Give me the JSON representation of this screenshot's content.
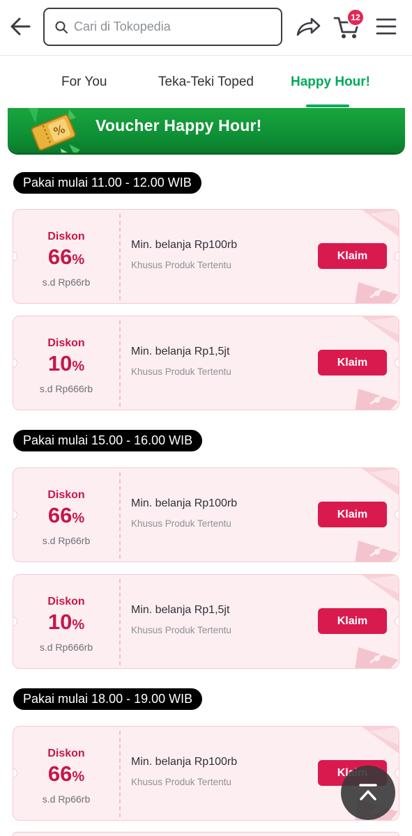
{
  "header": {
    "search_placeholder": "Cari di Tokopedia",
    "cart_count": "12"
  },
  "tabs": [
    {
      "label": "For You",
      "active": false
    },
    {
      "label": "Teka-Teki Toped",
      "active": false
    },
    {
      "label": "Happy Hour!",
      "active": true
    }
  ],
  "banner": {
    "title": "Voucher Happy Hour!"
  },
  "slots": [
    {
      "label": "Pakai mulai 11.00 - 12.00 WIB",
      "vouchers": [
        {
          "discount_label": "Diskon",
          "discount_value": "66",
          "percent": "%",
          "max": "s.d Rp66rb",
          "min_purchase": "Min. belanja Rp100rb",
          "note": "Khusus Produk Tertentu",
          "button": "Klaim"
        },
        {
          "discount_label": "Diskon",
          "discount_value": "10",
          "percent": "%",
          "max": "s.d Rp666rb",
          "min_purchase": "Min. belanja Rp1,5jt",
          "note": "Khusus Produk Tertentu",
          "button": "Klaim"
        }
      ]
    },
    {
      "label": "Pakai mulai 15.00 - 16.00 WIB",
      "vouchers": [
        {
          "discount_label": "Diskon",
          "discount_value": "66",
          "percent": "%",
          "max": "s.d Rp66rb",
          "min_purchase": "Min. belanja Rp100rb",
          "note": "Khusus Produk Tertentu",
          "button": "Klaim"
        },
        {
          "discount_label": "Diskon",
          "discount_value": "10",
          "percent": "%",
          "max": "s.d Rp666rb",
          "min_purchase": "Min. belanja Rp1,5jt",
          "note": "Khusus Produk Tertentu",
          "button": "Klaim"
        }
      ]
    },
    {
      "label": "Pakai mulai 18.00 - 19.00 WIB",
      "vouchers": [
        {
          "discount_label": "Diskon",
          "discount_value": "66",
          "percent": "%",
          "max": "s.d Rp66rb",
          "min_purchase": "Min. belanja Rp100rb",
          "note": "Khusus Produk Tertentu",
          "button": "Klaim"
        }
      ]
    }
  ],
  "colors": {
    "accent_green": "#00aa5b",
    "voucher_red": "#d91a4f",
    "badge_red": "#e02954"
  },
  "icons": [
    "back-arrow-icon",
    "search-icon",
    "share-icon",
    "cart-icon",
    "menu-icon",
    "voucher-ticket-icon",
    "scroll-to-top-icon"
  ]
}
